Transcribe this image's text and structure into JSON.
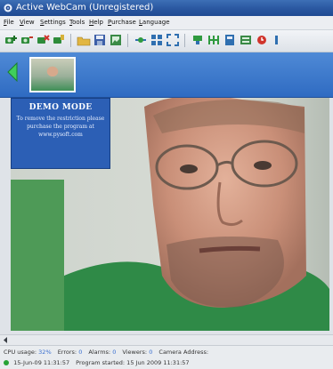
{
  "window": {
    "title": "Active WebCam (Unregistered)"
  },
  "menu": [
    "File",
    "View",
    "Settings",
    "Tools",
    "Help",
    "Purchase",
    "Language"
  ],
  "toolbar_icons": [
    "add-camera-icon",
    "camera-list-icon",
    "delete-camera-icon",
    "camera-properties-icon",
    "open-folder-icon",
    "save-icon",
    "snapshot-icon",
    "connect-icon",
    "grid-view-icon",
    "fullscreen-icon",
    "broadcast-icon",
    "motion-detect-icon",
    "schedule-icon",
    "archive-icon",
    "alarm-icon",
    "more-icon"
  ],
  "demo": {
    "title": "DEMO MODE",
    "text": "To remove the restriction please purchase the program at www.pysoft.com"
  },
  "status": {
    "cpu_label": "CPU usage:",
    "cpu_value": "32%",
    "errors_label": "Errors:",
    "errors_value": "0",
    "alarms_label": "Alarms:",
    "alarms_value": "0",
    "viewers_label": "Viewers:",
    "viewers_value": "0",
    "camera_address_label": "Camera Address:",
    "timestamp": "15-Jun-09 11:31:57",
    "program_started": "Program started: 15 Jun 2009 11:31:57"
  },
  "colors": {
    "title_bar": "#2a57a0",
    "thumb_strip": "#3a78cc",
    "demo_box": "#2c5fb5",
    "status_value": "#3a6fd0",
    "status_ok": "#27a336"
  }
}
